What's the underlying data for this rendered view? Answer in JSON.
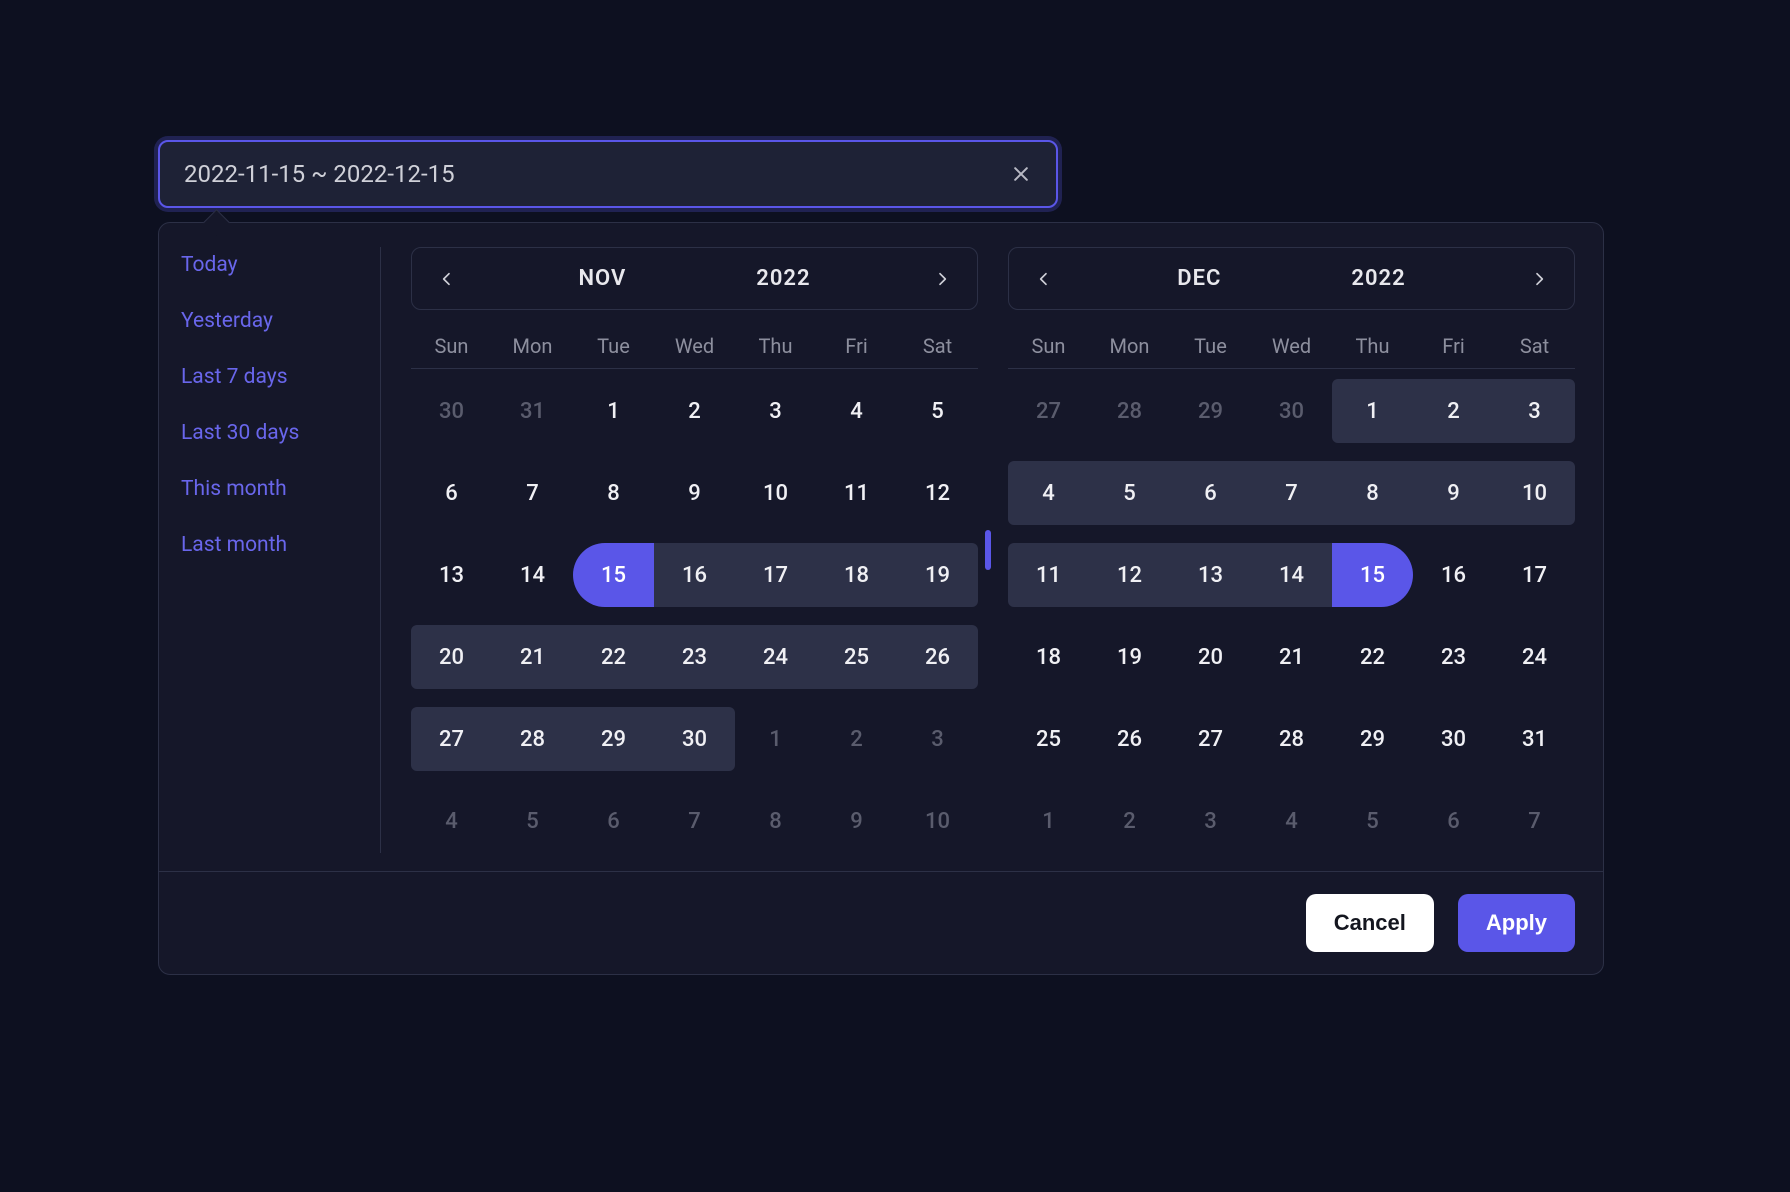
{
  "input": {
    "value": "2022-11-15 ~ 2022-12-15"
  },
  "shortcuts": [
    "Today",
    "Yesterday",
    "Last 7 days",
    "Last 30 days",
    "This month",
    "Last month"
  ],
  "weekdays": [
    "Sun",
    "Mon",
    "Tue",
    "Wed",
    "Thu",
    "Fri",
    "Sat"
  ],
  "calendars": {
    "left": {
      "month": "NOV",
      "year": "2022",
      "grid": [
        [
          {
            "n": 30,
            "out": true
          },
          {
            "n": 31,
            "out": true
          },
          {
            "n": 1
          },
          {
            "n": 2
          },
          {
            "n": 3
          },
          {
            "n": 4
          },
          {
            "n": 5
          }
        ],
        [
          {
            "n": 6
          },
          {
            "n": 7
          },
          {
            "n": 8
          },
          {
            "n": 9
          },
          {
            "n": 10
          },
          {
            "n": 11
          },
          {
            "n": 12
          }
        ],
        [
          {
            "n": 13
          },
          {
            "n": 14
          },
          {
            "n": 15,
            "start": true
          },
          {
            "n": 16,
            "in": true
          },
          {
            "n": 17,
            "in": true
          },
          {
            "n": 18,
            "in": true
          },
          {
            "n": 19,
            "in": true,
            "rright": true
          }
        ],
        [
          {
            "n": 20,
            "in": true,
            "rleft": true
          },
          {
            "n": 21,
            "in": true
          },
          {
            "n": 22,
            "in": true
          },
          {
            "n": 23,
            "in": true
          },
          {
            "n": 24,
            "in": true
          },
          {
            "n": 25,
            "in": true
          },
          {
            "n": 26,
            "in": true,
            "rright": true
          }
        ],
        [
          {
            "n": 27,
            "in": true,
            "rleft": true
          },
          {
            "n": 28,
            "in": true
          },
          {
            "n": 29,
            "in": true
          },
          {
            "n": 30,
            "in": true,
            "rright": true
          },
          {
            "n": 1,
            "out": true
          },
          {
            "n": 2,
            "out": true
          },
          {
            "n": 3,
            "out": true
          }
        ],
        [
          {
            "n": 4,
            "out": true
          },
          {
            "n": 5,
            "out": true
          },
          {
            "n": 6,
            "out": true
          },
          {
            "n": 7,
            "out": true
          },
          {
            "n": 8,
            "out": true
          },
          {
            "n": 9,
            "out": true
          },
          {
            "n": 10,
            "out": true
          }
        ]
      ]
    },
    "right": {
      "month": "DEC",
      "year": "2022",
      "grid": [
        [
          {
            "n": 27,
            "out": true
          },
          {
            "n": 28,
            "out": true
          },
          {
            "n": 29,
            "out": true
          },
          {
            "n": 30,
            "out": true
          },
          {
            "n": 1,
            "in": true,
            "rleft": true
          },
          {
            "n": 2,
            "in": true
          },
          {
            "n": 3,
            "in": true,
            "rright": true
          }
        ],
        [
          {
            "n": 4,
            "in": true,
            "rleft": true
          },
          {
            "n": 5,
            "in": true
          },
          {
            "n": 6,
            "in": true
          },
          {
            "n": 7,
            "in": true
          },
          {
            "n": 8,
            "in": true
          },
          {
            "n": 9,
            "in": true
          },
          {
            "n": 10,
            "in": true,
            "rright": true
          }
        ],
        [
          {
            "n": 11,
            "in": true,
            "rleft": true
          },
          {
            "n": 12,
            "in": true
          },
          {
            "n": 13,
            "in": true
          },
          {
            "n": 14,
            "in": true
          },
          {
            "n": 15,
            "end": true
          },
          {
            "n": 16
          },
          {
            "n": 17
          }
        ],
        [
          {
            "n": 18
          },
          {
            "n": 19
          },
          {
            "n": 20
          },
          {
            "n": 21
          },
          {
            "n": 22
          },
          {
            "n": 23
          },
          {
            "n": 24
          }
        ],
        [
          {
            "n": 25
          },
          {
            "n": 26
          },
          {
            "n": 27
          },
          {
            "n": 28
          },
          {
            "n": 29
          },
          {
            "n": 30
          },
          {
            "n": 31
          }
        ],
        [
          {
            "n": 1,
            "out": true
          },
          {
            "n": 2,
            "out": true
          },
          {
            "n": 3,
            "out": true
          },
          {
            "n": 4,
            "out": true
          },
          {
            "n": 5,
            "out": true
          },
          {
            "n": 6,
            "out": true
          },
          {
            "n": 7,
            "out": true
          }
        ]
      ]
    }
  },
  "footer": {
    "cancel": "Cancel",
    "apply": "Apply"
  }
}
